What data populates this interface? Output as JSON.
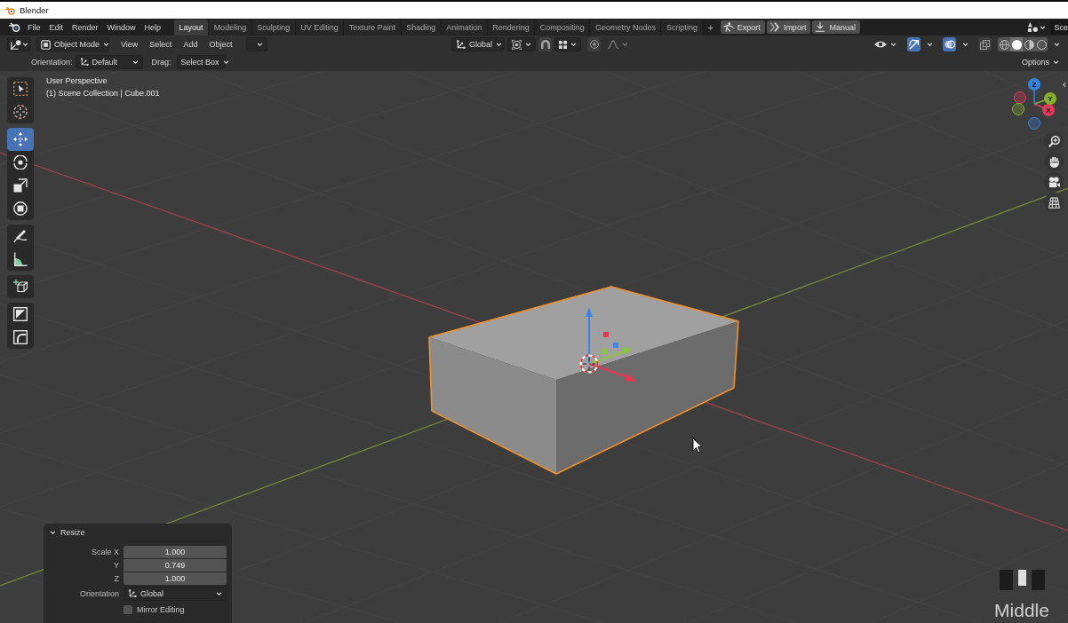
{
  "window": {
    "title": "Blender"
  },
  "topbar": {
    "menus": [
      "File",
      "Edit",
      "Render",
      "Window",
      "Help"
    ],
    "workspaces": [
      {
        "label": "Layout",
        "selected": true
      },
      {
        "label": "Modeling",
        "selected": false
      },
      {
        "label": "Sculpting",
        "selected": false
      },
      {
        "label": "UV Editing",
        "selected": false
      },
      {
        "label": "Texture Paint",
        "selected": false
      },
      {
        "label": "Shading",
        "selected": false
      },
      {
        "label": "Animation",
        "selected": false
      },
      {
        "label": "Rendering",
        "selected": false
      },
      {
        "label": "Compositing",
        "selected": false
      },
      {
        "label": "Geometry Nodes",
        "selected": false
      },
      {
        "label": "Scripting",
        "selected": false
      }
    ],
    "add_tab": "+",
    "addon_buttons": [
      {
        "kind": "export",
        "label": "Export"
      },
      {
        "kind": "import",
        "label": "Import"
      },
      {
        "kind": "manual",
        "label": "Manual"
      }
    ],
    "scene": "Sce"
  },
  "header": {
    "mode": "Object Mode",
    "menus": [
      "View",
      "Select",
      "Add",
      "Object"
    ],
    "transform_orientation": "Global",
    "snap": {
      "on": false
    },
    "proportional": {
      "on": false
    },
    "gizmos": {
      "on": true
    },
    "overlays": {
      "on": true
    },
    "xray": {
      "on": false
    },
    "shading": [
      {
        "kind": "wireframe",
        "selected": false
      },
      {
        "kind": "solid",
        "selected": true
      },
      {
        "kind": "material",
        "selected": false
      },
      {
        "kind": "rendered",
        "selected": false
      }
    ]
  },
  "tool_settings": {
    "orientation_label": "Orientation:",
    "orientation": "Default",
    "drag_label": "Drag:",
    "drag": "Select Box",
    "options": "Options"
  },
  "viewport": {
    "view_name": "User Perspective",
    "collection": "(1) Scene Collection | Cube.001",
    "toolbar": [
      {
        "tools": [
          {
            "kind": "select_box",
            "selected": false
          },
          {
            "kind": "cursor",
            "selected": false
          }
        ]
      },
      {
        "tools": [
          {
            "kind": "move",
            "selected": true
          },
          {
            "kind": "rotate",
            "selected": false
          },
          {
            "kind": "scale",
            "selected": false
          },
          {
            "kind": "transform",
            "selected": false
          }
        ]
      },
      {
        "tools": [
          {
            "kind": "annotate",
            "selected": false
          },
          {
            "kind": "measure",
            "selected": false
          }
        ]
      },
      {
        "tools": [
          {
            "kind": "add_cube",
            "selected": false
          }
        ]
      },
      {
        "tools": [
          {
            "kind": "square_diagonal",
            "selected": false
          },
          {
            "kind": "rounded_corner",
            "selected": false
          }
        ]
      }
    ],
    "gizmo_axes": [
      {
        "label": "X",
        "color": "#e33a5c"
      },
      {
        "label": "Y",
        "color": "#86b02c"
      },
      {
        "label": "Z",
        "color": "#3483e3"
      }
    ]
  },
  "last_operation": {
    "title": "Resize",
    "expanded": true,
    "fields": [
      {
        "label": "Scale X",
        "value": "1.000"
      },
      {
        "label": "Y",
        "value": "0.749"
      },
      {
        "label": "Z",
        "value": "1.000"
      }
    ],
    "orientation_label": "Orientation",
    "orientation": "Global",
    "checkboxes": [
      {
        "label": "Mirror Editing",
        "checked": false
      }
    ]
  },
  "screencast": {
    "mouse_buttons": [
      {
        "kind": "left",
        "pressed": false
      },
      {
        "kind": "middle",
        "pressed": true
      },
      {
        "kind": "right",
        "pressed": false
      }
    ],
    "caption": "Middle"
  }
}
